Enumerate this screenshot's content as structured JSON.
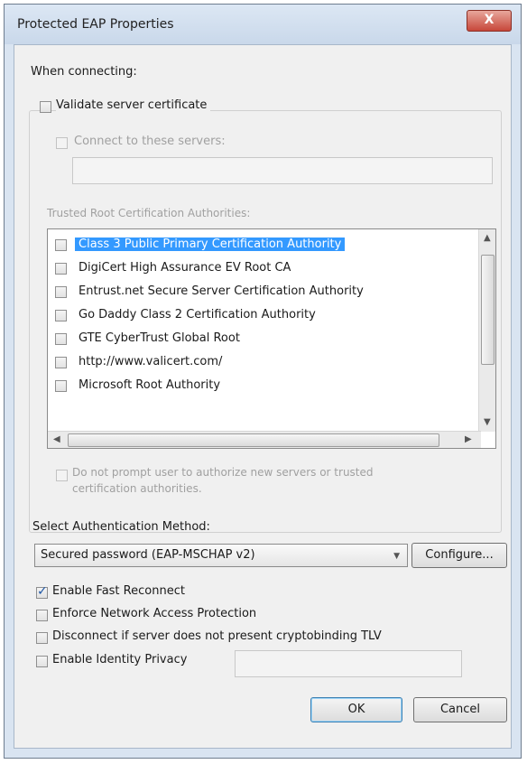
{
  "window": {
    "title": "Protected EAP Properties",
    "close_glyph": "X"
  },
  "when_connecting": "When connecting:",
  "validate_cert": {
    "label": "Validate server certificate",
    "checked": false
  },
  "connect_servers": {
    "label": "Connect to these servers:",
    "checked": false,
    "value": ""
  },
  "trusted_roots": {
    "label": "Trusted Root Certification Authorities:",
    "items": [
      {
        "label": "Class 3 Public Primary Certification Authority",
        "checked": false,
        "selected": true
      },
      {
        "label": "DigiCert High Assurance EV Root CA",
        "checked": false
      },
      {
        "label": "Entrust.net Secure Server Certification Authority",
        "checked": false
      },
      {
        "label": "Go Daddy Class 2 Certification Authority",
        "checked": false
      },
      {
        "label": "GTE CyberTrust Global Root",
        "checked": false
      },
      {
        "label": "http://www.valicert.com/",
        "checked": false
      },
      {
        "label": "Microsoft Root Authority",
        "checked": false
      }
    ]
  },
  "do_not_prompt": {
    "line1": "Do not prompt user to authorize new servers or trusted",
    "line2": "certification authorities.",
    "checked": false
  },
  "auth_method": {
    "label": "Select Authentication Method:",
    "selected": "Secured password (EAP-MSCHAP v2)",
    "configure_label": "Configure..."
  },
  "options": [
    {
      "label": "Enable Fast Reconnect",
      "checked": true
    },
    {
      "label": "Enforce Network Access Protection",
      "checked": false
    },
    {
      "label": "Disconnect if server does not present cryptobinding TLV",
      "checked": false
    },
    {
      "label": "Enable Identity Privacy",
      "checked": false
    }
  ],
  "identity_privacy_value": "",
  "buttons": {
    "ok": "OK",
    "cancel": "Cancel"
  }
}
